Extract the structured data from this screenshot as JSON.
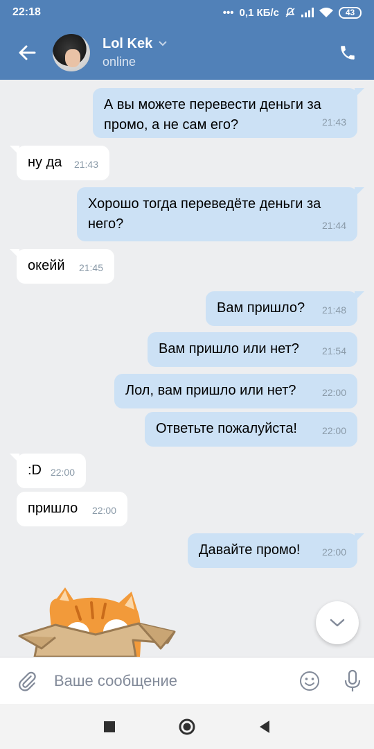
{
  "status_bar": {
    "time": "22:18",
    "network_speed": "0,1 КБ/с",
    "battery": "43"
  },
  "header": {
    "name": "Lol Kek",
    "status": "online"
  },
  "messages": [
    {
      "dir": "out",
      "text": "А вы можете перевести деньги за промо, а не сам его?",
      "time": "21:43"
    },
    {
      "dir": "in",
      "text": "ну да",
      "time": "21:43"
    },
    {
      "dir": "out",
      "text": "Хорошо тогда переведёте деньги за него?",
      "time": "21:44"
    },
    {
      "dir": "in",
      "text": "окейй",
      "time": "21:45"
    },
    {
      "dir": "out",
      "text": "Вам пришло?",
      "time": "21:48"
    },
    {
      "dir": "out",
      "text": "Вам пришло или нет?",
      "time": "21:54"
    },
    {
      "dir": "out",
      "text": "Лол, вам пришло или нет?",
      "time": "22:00"
    },
    {
      "dir": "out",
      "text": "Ответьте пожалуйста!",
      "time": "22:00"
    },
    {
      "dir": "in",
      "text": ":D",
      "time": "22:00"
    },
    {
      "dir": "in",
      "text": "пришло",
      "time": "22:00"
    },
    {
      "dir": "out",
      "text": "Давайте промо!",
      "time": "22:00"
    }
  ],
  "composer": {
    "placeholder": "Ваше сообщение"
  },
  "icons": [
    "back-arrow-icon",
    "chevron-down-icon",
    "phone-icon",
    "paperclip-icon",
    "smile-icon",
    "microphone-icon",
    "scroll-down-icon",
    "nav-recent-icon",
    "nav-home-icon",
    "nav-back-icon"
  ],
  "colors": {
    "header_bg": "#5181b8",
    "outgoing_bubble": "#cce1f5",
    "incoming_bubble": "#ffffff",
    "chat_bg": "#edeef0"
  }
}
